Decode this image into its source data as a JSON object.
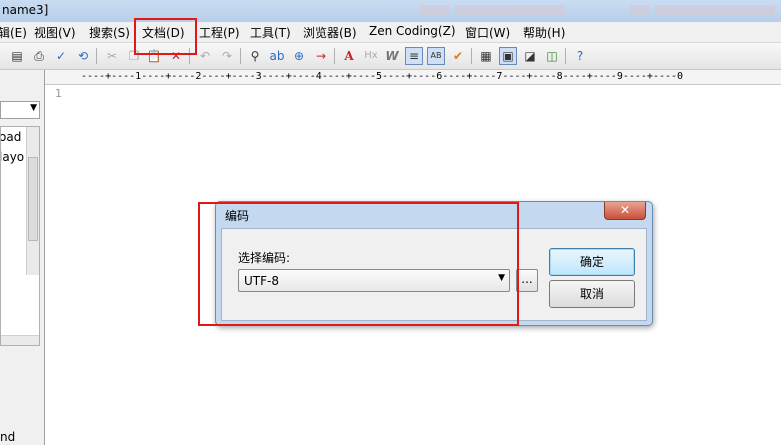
{
  "window": {
    "title_fragment": "name3]"
  },
  "menubar": {
    "items": [
      {
        "label": "辑(E)"
      },
      {
        "label": "视图(V)"
      },
      {
        "label": "搜索(S)"
      },
      {
        "label": "文档(D)"
      },
      {
        "label": "工程(P)"
      },
      {
        "label": "工具(T)"
      },
      {
        "label": "浏览器(B)"
      },
      {
        "label": "Zen Coding(Z)"
      },
      {
        "label": "窗口(W)"
      },
      {
        "label": "帮助(H)"
      }
    ]
  },
  "toolbar": {
    "icons": [
      "print-preview-icon",
      "print-icon",
      "spellcheck-icon",
      "refresh-icon",
      "cut-icon",
      "copy-icon",
      "paste-icon",
      "delete-icon",
      "undo-icon",
      "redo-icon",
      "find-icon",
      "replace-icon",
      "find-in-files-icon",
      "goto-icon",
      "font-icon",
      "hx-icon",
      "wrap-icon",
      "indent-icon",
      "case-icon",
      "check-icon",
      "view1-icon",
      "view2-icon",
      "view3-icon",
      "view4-icon",
      "help-icon"
    ]
  },
  "sidebar": {
    "list_items": [
      "oad",
      "layo"
    ],
    "bottom_text": "nd"
  },
  "ruler": {
    "text": "----+----1----+----2----+----3----+----4----+----5----+----6----+----7----+----8----+----9----+----0"
  },
  "editor": {
    "line_number": "1"
  },
  "dialog": {
    "title": "编码",
    "close_label": "✕",
    "field_label": "选择编码:",
    "encoding_value": "UTF-8",
    "browse_label": "...",
    "ok_label": "确定",
    "cancel_label": "取消"
  },
  "colors": {
    "highlight": "#e01818",
    "title_bar": "#c9dcf1",
    "dialog_frame": "#c4d8ef"
  }
}
